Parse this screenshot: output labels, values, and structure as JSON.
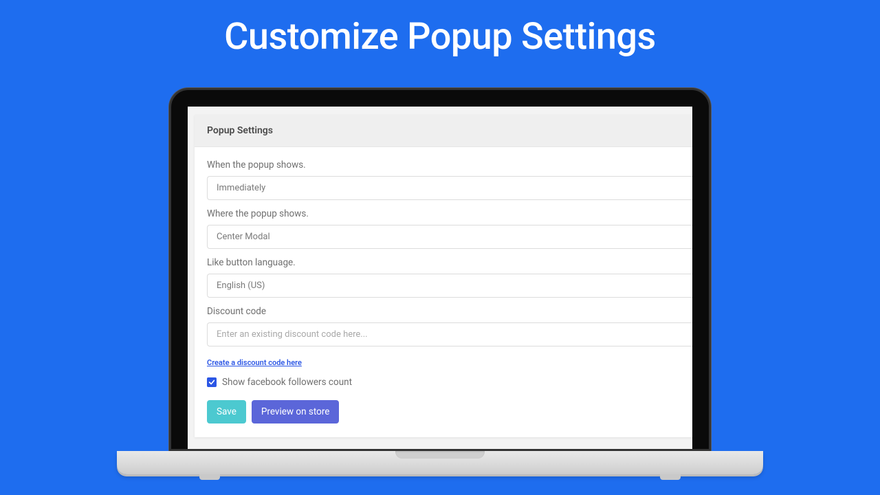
{
  "pageTitle": "Customize Popup Settings",
  "card": {
    "header": "Popup Settings",
    "fields": {
      "when": {
        "label": "When the popup shows.",
        "value": "Immediately"
      },
      "where": {
        "label": "Where the popup shows.",
        "value": "Center Modal"
      },
      "lang": {
        "label": "Like button language.",
        "value": "English (US)"
      },
      "discount": {
        "label": "Discount code",
        "placeholder": "Enter an existing discount code here..."
      }
    },
    "createLink": "Create a discount code here",
    "checkbox": {
      "label": "Show facebook followers count",
      "checked": true
    },
    "buttons": {
      "save": "Save",
      "preview": "Preview on store"
    }
  }
}
